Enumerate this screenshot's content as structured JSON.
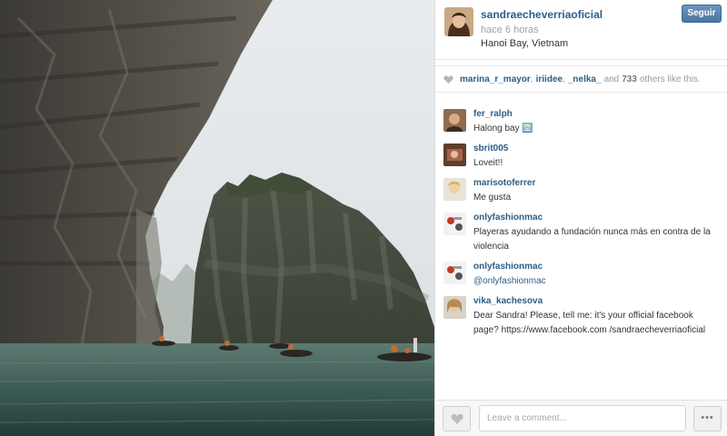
{
  "post": {
    "username": "sandraecheverriaoficial",
    "time": "hace 6 horas",
    "location": "Hanoi Bay, Vietnam",
    "follow_label": "Seguir"
  },
  "likes": {
    "likers": [
      "marina_r_mayor",
      "iriidee",
      "_nelka_"
    ],
    "and_text": "and",
    "others_count": "733",
    "others_text": "others like this."
  },
  "comments": [
    {
      "user": "fer_ralph",
      "text": "Halong bay 🈳"
    },
    {
      "user": "sbrit005",
      "text": "Loveit!!"
    },
    {
      "user": "marisotoferrer",
      "text": "Me gusta"
    },
    {
      "user": "onlyfashionmac",
      "text": "Playeras ayudando a fundación nunca más en contra de la violencia"
    },
    {
      "user": "onlyfashionmac",
      "text": "@onlyfashionmac"
    },
    {
      "user": "vika_kachesova",
      "text": "Dear Sandra! Please, tell me: it's your official facebook page? https://www.facebook.com /sandraecheverriaoficial"
    }
  ],
  "footer": {
    "comment_placeholder": "Leave a comment...",
    "more_label": "•••"
  },
  "icons": {
    "like": "heart-icon",
    "more": "more-dots-icon"
  },
  "colors": {
    "link": "#2e5e86",
    "follow_button": "#5a84ad",
    "muted": "#a0a0a0"
  }
}
